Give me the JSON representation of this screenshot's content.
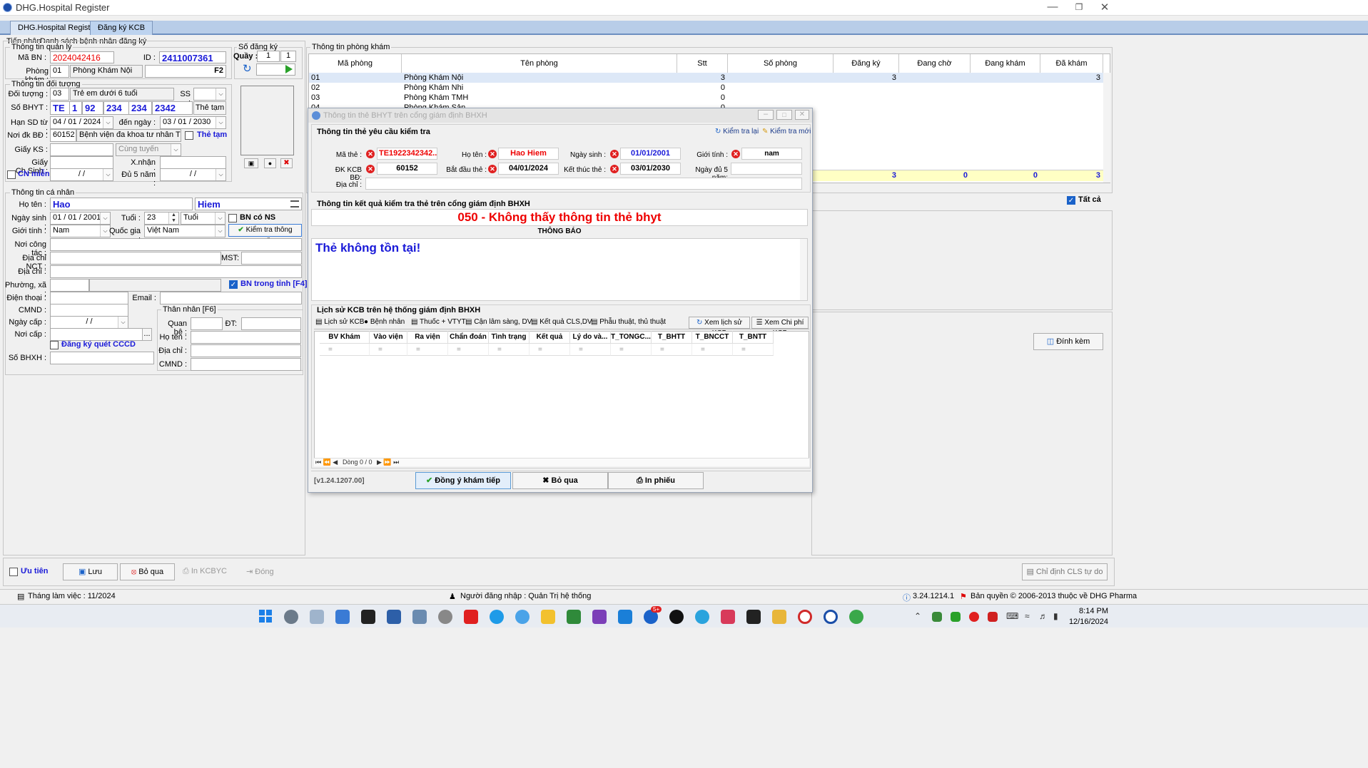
{
  "app": {
    "title": "DHG.Hospital Register"
  },
  "main_tabs": [
    {
      "label": "DHG.Hospital Register"
    },
    {
      "label": "Đăng ký KCB"
    }
  ],
  "sub_tabs": [
    {
      "label": "Tiếp nhận"
    },
    {
      "label": "Danh sách bệnh nhân đăng ký"
    }
  ],
  "admin": {
    "group": "Thông tin quản lý",
    "mabn_label": "Mã BN :",
    "mabn": "2024042416",
    "id_label": "ID :",
    "id": "2411007361",
    "phongkham_label": "Phòng khám :",
    "phongkham_code": "01",
    "phongkham_name": "Phòng Khám Nội",
    "f2": "F2"
  },
  "sodangky": {
    "group": "Số đăng ký",
    "quay_label": "Quầy :",
    "quay1": "1",
    "quay2": "1"
  },
  "doituong": {
    "group": "Thông tin đối tượng",
    "doituong_label": "Đối tượng :",
    "doituong_code": "03",
    "doituong_name": "Trẻ em dưới 6 tuổi",
    "ss_label": "SS :",
    "sobhyt_label": "Số BHYT :",
    "bhyt_parts": [
      "TE",
      "1",
      "92",
      "234",
      "234",
      "2342"
    ],
    "thetam_btn": "Thẻ tạm",
    "hansd_label": "Hạn SD từ :",
    "tu_ngay": "04 / 01 / 2024",
    "den_ngay_label": "đến ngày :",
    "den_ngay": "03 / 01 / 2030",
    "noidk_label": "Nơi đk BĐ :",
    "noidk_code": "60152",
    "noidk_name": "Bệnh viện đa khoa tư nhân Tâm Phú",
    "thetam_chk": "Thẻ tạm",
    "giayks_label": "Giấy KS :",
    "cungtuyen": "Cùng tuyến",
    "giaychsinh_label": "Giấy Ch.Sinh :",
    "xnhan_label": "X.nhận :",
    "cnmien_label": "CN miễn",
    "cnmien_date": "/    /",
    "du5nam_label": "Đủ 5 năm :",
    "du5nam_date": "/    /"
  },
  "canhan": {
    "group": "Thông tin cá nhân",
    "hoten_label": "Họ tên :",
    "ho": "Hao",
    "ten": "Hiem",
    "ngaysinh_label": "Ngày sinh :",
    "ngaysinh": "01 / 01 / 2001",
    "tuoi_label": "Tuổi :",
    "tuoi": "23",
    "tuoi_unit": "Tuổi",
    "bncons_label": "BN có NS",
    "gioitinh_label": "Giới tính :",
    "gioitinh": "Nam",
    "quocgia_label": "Quốc gia :",
    "quocgia": "Việt Nam",
    "kiemtra_btn": "Kiểm tra thông tuyến",
    "noicongtac_label": "Nơi công tác :",
    "diachinct_label": "Địa chỉ  NCT :",
    "mst_label": "MST:",
    "diachi_label": "Địa chỉ :",
    "phuongxa_label": "Phường, xã :",
    "bntrongtinh_label": "BN trong tỉnh [F4]",
    "dienthoai_label": "Điện thoại :",
    "email_label": "Email :",
    "cmnd_label": "CMND :",
    "ngaycap_label": "Ngày cấp :",
    "ngaycap": "/    /",
    "noicap_label": "Nơi cấp :",
    "dangkyquet_label": "Đăng ký quét CCCD",
    "sobhxh_label": "Số BHXH :"
  },
  "thannhan": {
    "group": "Thân nhân [F6]",
    "quanhe_label": "Quan hệ :",
    "dt_label": "ĐT:",
    "hoten_label": "Họ tên :",
    "diachi_label": "Địa chỉ :",
    "cmnd_label": "CMND :"
  },
  "phongkham_table": {
    "group": "Thông tin phòng khám",
    "headers": [
      "Mã phòng",
      "Tên phòng",
      "Stt",
      "Số phòng",
      "Đăng ký",
      "Đang chờ",
      "Đang khám",
      "Đã khám"
    ],
    "rows": [
      {
        "ma": "01",
        "ten": "Phòng Khám Nội",
        "stt": "3",
        "dangky": "3",
        "dakham": "3"
      },
      {
        "ma": "02",
        "ten": "Phòng Khám Nhi",
        "stt": "0",
        "dangky": "",
        "dakham": ""
      },
      {
        "ma": "03",
        "ten": "Phòng Khám TMH",
        "stt": "0",
        "dangky": "",
        "dakham": ""
      },
      {
        "ma": "04",
        "ten": "Phòng Khám Sản",
        "stt": "0",
        "dangky": "",
        "dakham": ""
      }
    ],
    "totals": {
      "dangky": "3",
      "dangcho": "0",
      "dangkham": "0",
      "dakham": "3"
    },
    "tatca": "Tất cả",
    "dinhkem": "Đính kèm"
  },
  "dialog": {
    "title": "Thông tin thẻ BHYT trên cổng giám định BHXH",
    "section1": "Thông tin thẻ yêu cầu kiểm tra",
    "kiemtralai": "Kiểm tra lại",
    "kiemtramoi": "Kiểm tra mới",
    "mathe_label": "Mã thẻ :",
    "mathe": "TE1922342342...",
    "hoten_label": "Họ tên :",
    "hoten": "Hao Hiem",
    "ngaysinh_label": "Ngày sinh :",
    "ngaysinh": "01/01/2001",
    "gioitinh_label": "Giới tính :",
    "gioitinh": "nam",
    "dkkcb_label": "ĐK KCB BĐ:",
    "dkkcb": "60152",
    "batdau_label": "Bắt đầu thẻ :",
    "batdau": "04/01/2024",
    "ketthuc_label": "Kết thúc thẻ :",
    "ketthuc": "03/01/2030",
    "ngaydu5nam_label": "Ngày đủ 5 năm:",
    "diachi_label": "Địa chỉ :",
    "section2": "Thông tin kết quả kiểm tra thẻ trên cổng giám định BHXH",
    "result_code": "050 - Không thấy thông tin thẻ bhyt",
    "thongbao_label": "THÔNG BÁO",
    "thongbao": "Thẻ không tồn tại!",
    "section3": "Lịch sử KCB trên hệ thống giám định BHXH",
    "history_tabs": [
      "Lịch sử KCB",
      "Bệnh nhân",
      "Thuốc + VTYT",
      "Cận lâm sàng, DV",
      "Kết quả CLS,DV",
      "Phẫu thuật, thủ thuật"
    ],
    "xemlichsu": "Xem lịch sử KCB",
    "xemchiphi": "Xem Chi phí KCB",
    "history_headers": [
      "BV Khám",
      "Vào viện",
      "Ra viện",
      "Chẩn đoán",
      "Tình trạng",
      "Kết quả",
      "Lý do và...",
      "T_TONGC...",
      "T_BHTT",
      "T_BNCCT",
      "T_BNTT"
    ],
    "pager": "Dòng 0 / 0",
    "version": "[v1.24.1207.00]",
    "dongy": "Đồng ý khám tiếp",
    "boqua": "Bỏ qua",
    "inphieu": "In phiếu"
  },
  "bottom": {
    "uutien": "Ưu tiên",
    "luu": "Lưu",
    "boqua": "Bỏ qua",
    "inkcbyc": "In KCBYC",
    "dong": "Đóng",
    "chidinh": "Chỉ định CLS tự do"
  },
  "status": {
    "thanglamviec": "Tháng làm việc : 11/2024",
    "nguoidangnhap": "Người đăng nhập : Quản Trị hệ thống",
    "version": "3.24.1214.1",
    "banquyen": "Bản quyền © 2006-2013 thuộc về DHG Pharma"
  },
  "taskbar": {
    "time": "8:14 PM",
    "date": "12/16/2024",
    "badge": "5+"
  },
  "colors": {
    "accent": "#1a62c9",
    "red": "#e00000",
    "blue": "#1a1ad8",
    "tab_blue": "#b8cde8",
    "total_row": "#ffffc4"
  }
}
